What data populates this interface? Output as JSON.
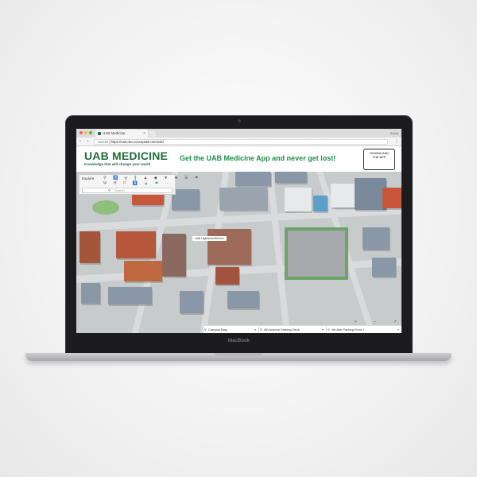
{
  "browser": {
    "tab_title": "UAB Medicine",
    "tab_close": "×",
    "user_label": "Guest",
    "nav_icons": "‹ › ↻",
    "secure_label": "Secure",
    "url": "https://uab.dev.concept3d.com/wdc/",
    "menu_icon": "⋮"
  },
  "header": {
    "logo_text": "UAB MEDICINE",
    "tagline": "Knowledge that will change your world",
    "promo_text": "Get the UAB Medicine App and never get lost!",
    "badge_apple": "",
    "badge_line1": "DOWNLOAD",
    "badge_line2": "THE APP"
  },
  "map": {
    "explore_label": "Explore",
    "icon_row_1": "⚲ ♿ ╦ ║ ▲ ◆ ▼ ✚ ☰ ⚑",
    "icon_row_2_a": "Ψ ⇈",
    "icon_row_2_b": "P",
    "icon_row_2_c": "♿ ▲ ⚑ ⋯",
    "search_icon": "⚲",
    "search_placeholder": "Search",
    "tooltip": "UAB Highlands/Women",
    "zoom_controls": "+ − ↗",
    "bottom_selects": [
      {
        "label": "Campus Map"
      },
      {
        "label": "4th Avenue Parking Deck"
      },
      {
        "label": "4th Ave Parking Floor 1"
      }
    ],
    "select_caret": "▾",
    "pin_icon": "⚲"
  },
  "laptop": {
    "model": "MacBook"
  },
  "colors": {
    "brand_green": "#1e6b3a",
    "promo_green": "#1e8f4a",
    "map_ground": "#c8cbcc"
  }
}
